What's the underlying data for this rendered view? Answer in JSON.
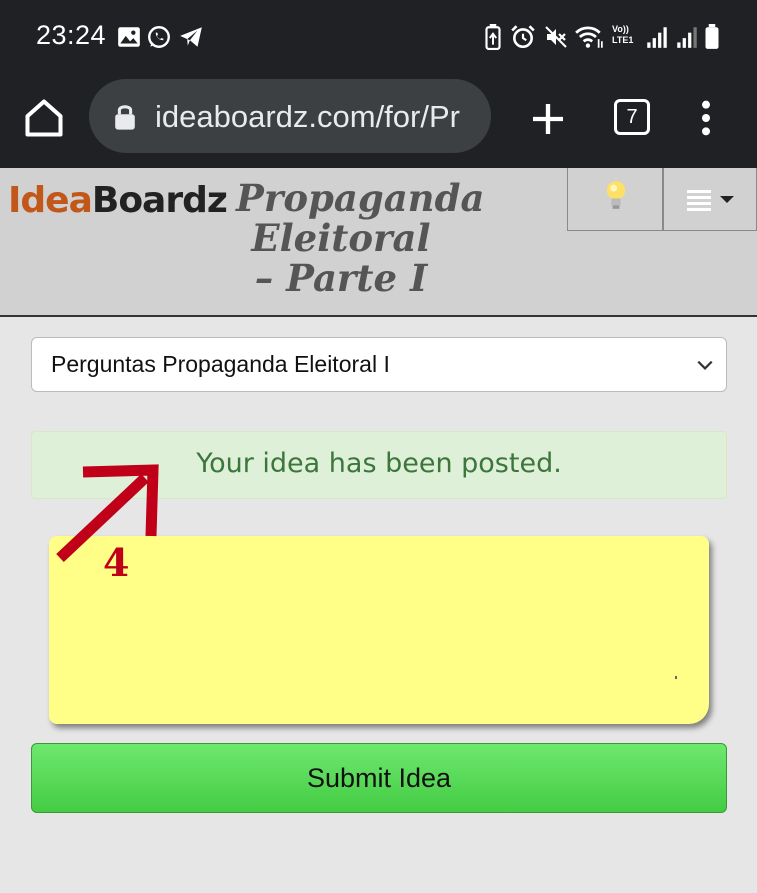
{
  "status_bar": {
    "time": "23:24",
    "left_icons": [
      "gallery-icon",
      "whatsapp-icon",
      "telegram-icon"
    ],
    "right_icons": [
      "battery-saver-icon",
      "alarm-icon",
      "mute-icon",
      "wifi-icon",
      "volte-icon",
      "signal-icon",
      "signal-icon",
      "battery-icon"
    ],
    "volte_label": "Vo)) LTE1"
  },
  "browser": {
    "url": "ideaboardz.com/for/Pr",
    "tab_count": "7"
  },
  "site": {
    "logo_idea": "Idea",
    "logo_boardz": "Boardz",
    "board_title": "Propaganda Eleitoral – Parte I",
    "buttons": [
      "lightbulb-icon",
      "list-menu-icon"
    ]
  },
  "content": {
    "section_select": "Perguntas Propaganda Eleitoral I",
    "alert": "Your idea has been posted.",
    "note_text": "",
    "submit_label": "Submit Idea"
  },
  "annotation": {
    "number": "4",
    "color": "#c00018"
  },
  "colors": {
    "bar_dark": "#202124",
    "header_gray": "#d1d1d1",
    "alert_green_bg": "#dff0d8",
    "alert_green_text": "#3c763d",
    "note_yellow": "#ffff88",
    "submit_green": "#44cc44"
  }
}
